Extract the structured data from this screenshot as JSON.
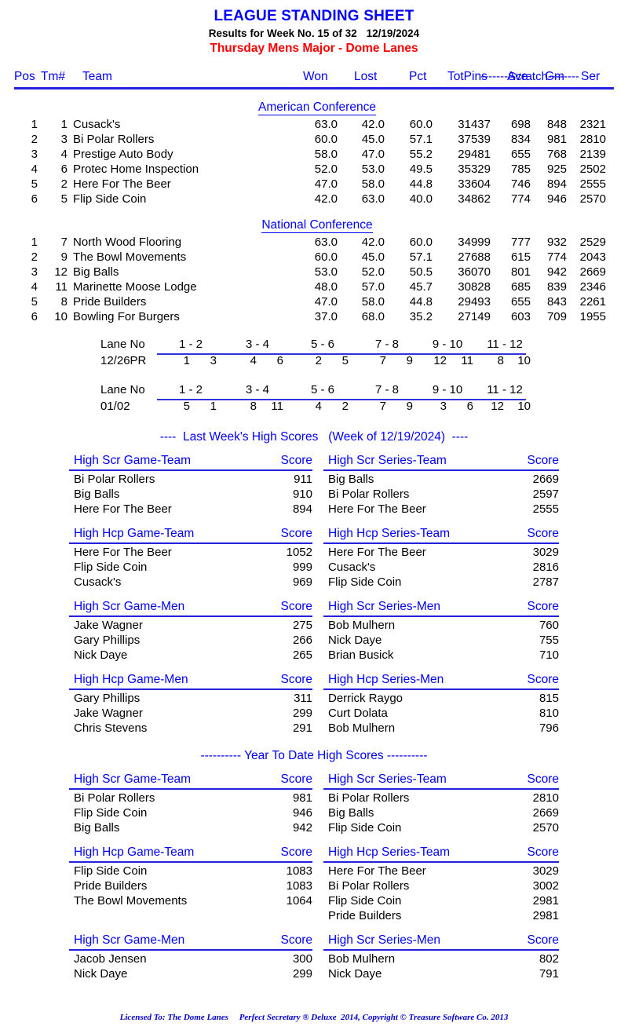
{
  "header": {
    "title": "LEAGUE STANDING SHEET",
    "results_label": "Results for Week No. 15 of 32",
    "results_date": "12/19/2024",
    "league_name": "Thursday Mens Major - Dome Lanes"
  },
  "standings": {
    "scratch_group_label": "-------Scratch--------",
    "columns": {
      "pos": "Pos",
      "tm": "Tm#",
      "team": "Team",
      "won": "Won",
      "lost": "Lost",
      "pct": "Pct",
      "totpins": "TotPins",
      "ave": "Ave",
      "gm": "Gm",
      "ser": "Ser"
    },
    "conferences": [
      {
        "name": "American Conference",
        "rows": [
          {
            "pos": "1",
            "tm": "1",
            "team": "Cusack's",
            "won": "63.0",
            "lost": "42.0",
            "pct": "60.0",
            "totpins": "31437",
            "ave": "698",
            "gm": "848",
            "ser": "2321"
          },
          {
            "pos": "2",
            "tm": "3",
            "team": "Bi Polar Rollers",
            "won": "60.0",
            "lost": "45.0",
            "pct": "57.1",
            "totpins": "37539",
            "ave": "834",
            "gm": "981",
            "ser": "2810"
          },
          {
            "pos": "3",
            "tm": "4",
            "team": "Prestige Auto Body",
            "won": "58.0",
            "lost": "47.0",
            "pct": "55.2",
            "totpins": "29481",
            "ave": "655",
            "gm": "768",
            "ser": "2139"
          },
          {
            "pos": "4",
            "tm": "6",
            "team": "Protec Home Inspection",
            "won": "52.0",
            "lost": "53.0",
            "pct": "49.5",
            "totpins": "35329",
            "ave": "785",
            "gm": "925",
            "ser": "2502"
          },
          {
            "pos": "5",
            "tm": "2",
            "team": "Here For The Beer",
            "won": "47.0",
            "lost": "58.0",
            "pct": "44.8",
            "totpins": "33604",
            "ave": "746",
            "gm": "894",
            "ser": "2555"
          },
          {
            "pos": "6",
            "tm": "5",
            "team": "Flip Side Coin",
            "won": "42.0",
            "lost": "63.0",
            "pct": "40.0",
            "totpins": "34862",
            "ave": "774",
            "gm": "946",
            "ser": "2570"
          }
        ]
      },
      {
        "name": "National Conference",
        "rows": [
          {
            "pos": "1",
            "tm": "7",
            "team": "North Wood Flooring",
            "won": "63.0",
            "lost": "42.0",
            "pct": "60.0",
            "totpins": "34999",
            "ave": "777",
            "gm": "932",
            "ser": "2529"
          },
          {
            "pos": "2",
            "tm": "9",
            "team": "The Bowl Movements",
            "won": "60.0",
            "lost": "45.0",
            "pct": "57.1",
            "totpins": "27688",
            "ave": "615",
            "gm": "774",
            "ser": "2043"
          },
          {
            "pos": "3",
            "tm": "12",
            "team": "Big Balls",
            "won": "53.0",
            "lost": "52.0",
            "pct": "50.5",
            "totpins": "36070",
            "ave": "801",
            "gm": "942",
            "ser": "2669"
          },
          {
            "pos": "4",
            "tm": "11",
            "team": "Marinette Moose Lodge",
            "won": "48.0",
            "lost": "57.0",
            "pct": "45.7",
            "totpins": "30828",
            "ave": "685",
            "gm": "839",
            "ser": "2346"
          },
          {
            "pos": "5",
            "tm": "8",
            "team": "Pride Builders",
            "won": "47.0",
            "lost": "58.0",
            "pct": "44.8",
            "totpins": "29493",
            "ave": "655",
            "gm": "843",
            "ser": "2261"
          },
          {
            "pos": "6",
            "tm": "10",
            "team": "Bowling For Burgers",
            "won": "37.0",
            "lost": "68.0",
            "pct": "35.2",
            "totpins": "27149",
            "ave": "603",
            "gm": "709",
            "ser": "1955"
          }
        ]
      }
    ]
  },
  "lane_schedules": [
    {
      "head_label": "Lane No",
      "pairs": [
        "1 - 2",
        "3 - 4",
        "5 - 6",
        "7 - 8",
        "9 - 10",
        "11 - 12"
      ],
      "date_label": "12/26PR",
      "teams": [
        [
          "1",
          "3"
        ],
        [
          "4",
          "6"
        ],
        [
          "2",
          "5"
        ],
        [
          "7",
          "9"
        ],
        [
          "12",
          "11"
        ],
        [
          "8",
          "10"
        ]
      ]
    },
    {
      "head_label": "Lane No",
      "pairs": [
        "1 - 2",
        "3 - 4",
        "5 - 6",
        "7 - 8",
        "9 - 10",
        "11 - 12"
      ],
      "date_label": "01/02",
      "teams": [
        [
          "5",
          "1"
        ],
        [
          "8",
          "11"
        ],
        [
          "4",
          "2"
        ],
        [
          "7",
          "9"
        ],
        [
          "3",
          "6"
        ],
        [
          "12",
          "10"
        ]
      ]
    }
  ],
  "last_week": {
    "banner": "----  Last Week's High Scores   (Week of 12/19/2024)  ----",
    "score_header": "Score",
    "blocks": [
      {
        "left": {
          "title": "High Scr Game-Team",
          "rows": [
            {
              "name": "Bi Polar Rollers",
              "value": "911"
            },
            {
              "name": "Big Balls",
              "value": "910"
            },
            {
              "name": "Here For The Beer",
              "value": "894"
            }
          ]
        },
        "right": {
          "title": "High Scr Series-Team",
          "rows": [
            {
              "name": "Big Balls",
              "value": "2669"
            },
            {
              "name": "Bi Polar Rollers",
              "value": "2597"
            },
            {
              "name": "Here For The Beer",
              "value": "2555"
            }
          ]
        }
      },
      {
        "left": {
          "title": "High Hcp Game-Team",
          "rows": [
            {
              "name": "Here For The Beer",
              "value": "1052"
            },
            {
              "name": "Flip Side Coin",
              "value": "999"
            },
            {
              "name": "Cusack's",
              "value": "969"
            }
          ]
        },
        "right": {
          "title": "High Hcp Series-Team",
          "rows": [
            {
              "name": "Here For The Beer",
              "value": "3029"
            },
            {
              "name": "Cusack's",
              "value": "2816"
            },
            {
              "name": "Flip Side Coin",
              "value": "2787"
            }
          ]
        }
      },
      {
        "left": {
          "title": "High Scr Game-Men",
          "rows": [
            {
              "name": "Jake Wagner",
              "value": "275"
            },
            {
              "name": "Gary Phillips",
              "value": "266"
            },
            {
              "name": "Nick Daye",
              "value": "265"
            }
          ]
        },
        "right": {
          "title": "High Scr Series-Men",
          "rows": [
            {
              "name": "Bob Mulhern",
              "value": "760"
            },
            {
              "name": "Nick Daye",
              "value": "755"
            },
            {
              "name": "Brian Busick",
              "value": "710"
            }
          ]
        }
      },
      {
        "left": {
          "title": "High Hcp Game-Men",
          "rows": [
            {
              "name": "Gary Phillips",
              "value": "311"
            },
            {
              "name": "Jake Wagner",
              "value": "299"
            },
            {
              "name": "Chris Stevens",
              "value": "291"
            }
          ]
        },
        "right": {
          "title": "High Hcp Series-Men",
          "rows": [
            {
              "name": "Derrick Raygo",
              "value": "815"
            },
            {
              "name": "Curt Dolata",
              "value": "810"
            },
            {
              "name": "Bob Mulhern",
              "value": "796"
            }
          ]
        }
      }
    ]
  },
  "year_to_date": {
    "banner": "---------- Year To Date High Scores ----------",
    "score_header": "Score",
    "blocks": [
      {
        "left": {
          "title": "High Scr Game-Team",
          "rows": [
            {
              "name": "Bi Polar Rollers",
              "value": "981"
            },
            {
              "name": "Flip Side Coin",
              "value": "946"
            },
            {
              "name": "Big Balls",
              "value": "942"
            }
          ]
        },
        "right": {
          "title": "High Scr Series-Team",
          "rows": [
            {
              "name": "Bi Polar Rollers",
              "value": "2810"
            },
            {
              "name": "Big Balls",
              "value": "2669"
            },
            {
              "name": "Flip Side Coin",
              "value": "2570"
            }
          ]
        }
      },
      {
        "left": {
          "title": "High Hcp Game-Team",
          "rows": [
            {
              "name": "Flip Side Coin",
              "value": "1083"
            },
            {
              "name": "Pride Builders",
              "value": "1083"
            },
            {
              "name": "The Bowl Movements",
              "value": "1064"
            }
          ]
        },
        "right": {
          "title": "High Hcp Series-Team",
          "rows": [
            {
              "name": "Here For The Beer",
              "value": "3029"
            },
            {
              "name": "Bi Polar Rollers",
              "value": "3002"
            },
            {
              "name": "Flip Side Coin",
              "value": "2981"
            },
            {
              "name": "Pride Builders",
              "value": "2981"
            }
          ]
        }
      },
      {
        "left": {
          "title": "High Scr Game-Men",
          "rows": [
            {
              "name": "Jacob Jensen",
              "value": "300"
            },
            {
              "name": "Nick Daye",
              "value": "299"
            }
          ]
        },
        "right": {
          "title": "High Scr Series-Men",
          "rows": [
            {
              "name": "Bob Mulhern",
              "value": "802"
            },
            {
              "name": "Nick Daye",
              "value": "791"
            }
          ]
        }
      }
    ]
  },
  "footer": {
    "text": "Licensed To: The Dome Lanes     Perfect Secretary ® Deluxe  2014, Copyright © Treasure Software Co. 2013"
  },
  "colors": {
    "blue": "#0000ff",
    "red": "#ff0000",
    "rule": "#2222dd",
    "text": "#000000"
  }
}
